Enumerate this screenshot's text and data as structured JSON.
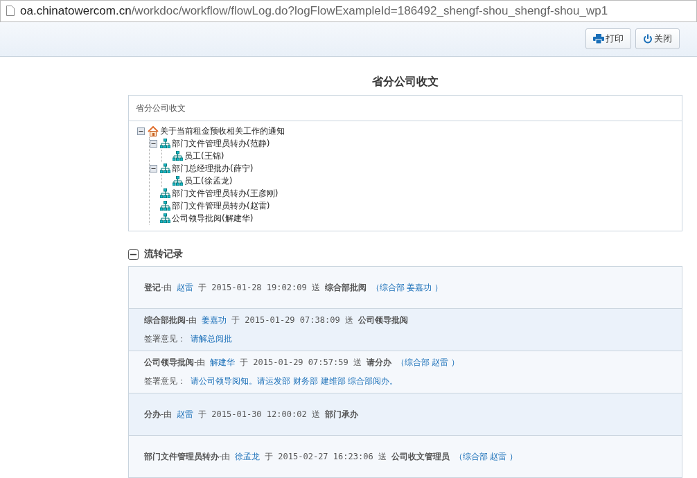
{
  "address_bar": {
    "host": "oa.chinatowercom.cn",
    "path": "/workdoc/workflow/flowLog.do?logFlowExampleId=186492_shengf-shou_shengf-shou_wp1"
  },
  "toolbar": {
    "buttons": [
      {
        "kind": "print",
        "label": "打印"
      },
      {
        "kind": "power",
        "label": "关闭"
      }
    ]
  },
  "title": "省分公司收文",
  "panel": {
    "heading": "省分公司收文",
    "tree": [
      {
        "kind": "home",
        "label": "关于当前租金预收相关工作的通知",
        "expanded": true,
        "children": [
          {
            "kind": "org",
            "label": "部门文件管理员转办(范静)",
            "expanded": true,
            "children": [
              {
                "kind": "org",
                "label": "员工(王锦)"
              }
            ]
          },
          {
            "kind": "org",
            "label": "部门总经理批办(薛宁)",
            "expanded": true,
            "children": [
              {
                "kind": "org",
                "label": "员工(徐孟龙)"
              }
            ]
          },
          {
            "kind": "org",
            "label": "部门文件管理员转办(王彦刚)"
          },
          {
            "kind": "org",
            "label": "部门文件管理员转办(赵雷)"
          },
          {
            "kind": "org",
            "label": "公司领导批阅(解建华)"
          }
        ]
      }
    ]
  },
  "section": {
    "title": "流转记录",
    "expanded": true
  },
  "records": [
    {
      "step": "登记",
      "by": "-由",
      "person": "赵雷",
      "at": "于",
      "time": "2015-01-28 19:02:09",
      "to": "送",
      "next": "综合部批阅",
      "recipient": "（综合部 姜嘉功 ）"
    },
    {
      "step": "综合部批阅",
      "by": "-由",
      "person": "姜嘉功",
      "at": "于",
      "time": "2015-01-29 07:38:09",
      "to": "送",
      "next": "公司领导批阅",
      "opinion_label": "签署意见：",
      "opinion": "请解总阅批"
    },
    {
      "step": "公司领导批阅",
      "by": "-由",
      "person": "解建华",
      "at": "于",
      "time": "2015-01-29 07:57:59",
      "to": "送",
      "next": "请分办",
      "recipient": "（综合部 赵雷 ）",
      "opinion_label": "签署意见：",
      "opinion": "请公司领导阅知。请运发部 财务部 建维部 综合部阅办。"
    },
    {
      "step": "分办",
      "by": "-由",
      "person": "赵雷",
      "at": "于",
      "time": "2015-01-30 12:00:02",
      "to": "送",
      "next": "部门承办"
    },
    {
      "step": "部门文件管理员转办",
      "by": "-由",
      "person": "徐孟龙",
      "at": "于",
      "time": "2015-02-27 16:23:06",
      "to": "送",
      "next": "公司收文管理员",
      "recipient": "（综合部 赵雷 ）"
    }
  ]
}
